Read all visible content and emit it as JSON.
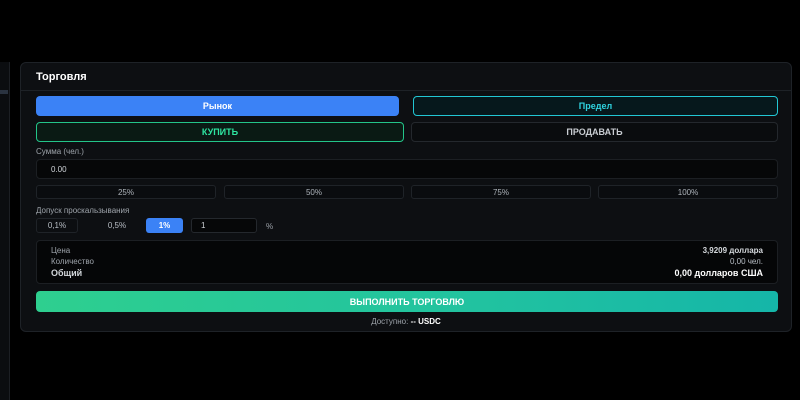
{
  "panel": {
    "title": "Торговля"
  },
  "order_type": {
    "market_label": "Рынок",
    "limit_label": "Предел",
    "selected": "market"
  },
  "side": {
    "buy_label": "КУПИТЬ",
    "sell_label": "ПРОДАВАТЬ",
    "selected": "buy"
  },
  "amount": {
    "label": "Сумма (чел.)",
    "value": "0.00"
  },
  "percent_buttons": [
    "25%",
    "50%",
    "75%",
    "100%"
  ],
  "slippage": {
    "label": "Допуск проскальзывания",
    "options": [
      "0,1%",
      "0,5%",
      "1%"
    ],
    "selected": "1%",
    "custom_value": "1",
    "unit": "%"
  },
  "summary": {
    "price_label": "Цена",
    "price_value": "3,9209 доллара",
    "qty_label": "Количество",
    "qty_value": "0,00 чел.",
    "total_label": "Общий",
    "total_value": "0,00 долларов США"
  },
  "execute_label": "ВЫПОЛНИТЬ ТОРГОВЛЮ",
  "available": {
    "label": "Доступно:",
    "value": "--",
    "token": "USDC"
  },
  "colors": {
    "accent_blue": "#3b82f6",
    "accent_cyan": "#22c7d4",
    "accent_green": "#23c489",
    "background": "#000000",
    "panel": "#0d0f12"
  }
}
